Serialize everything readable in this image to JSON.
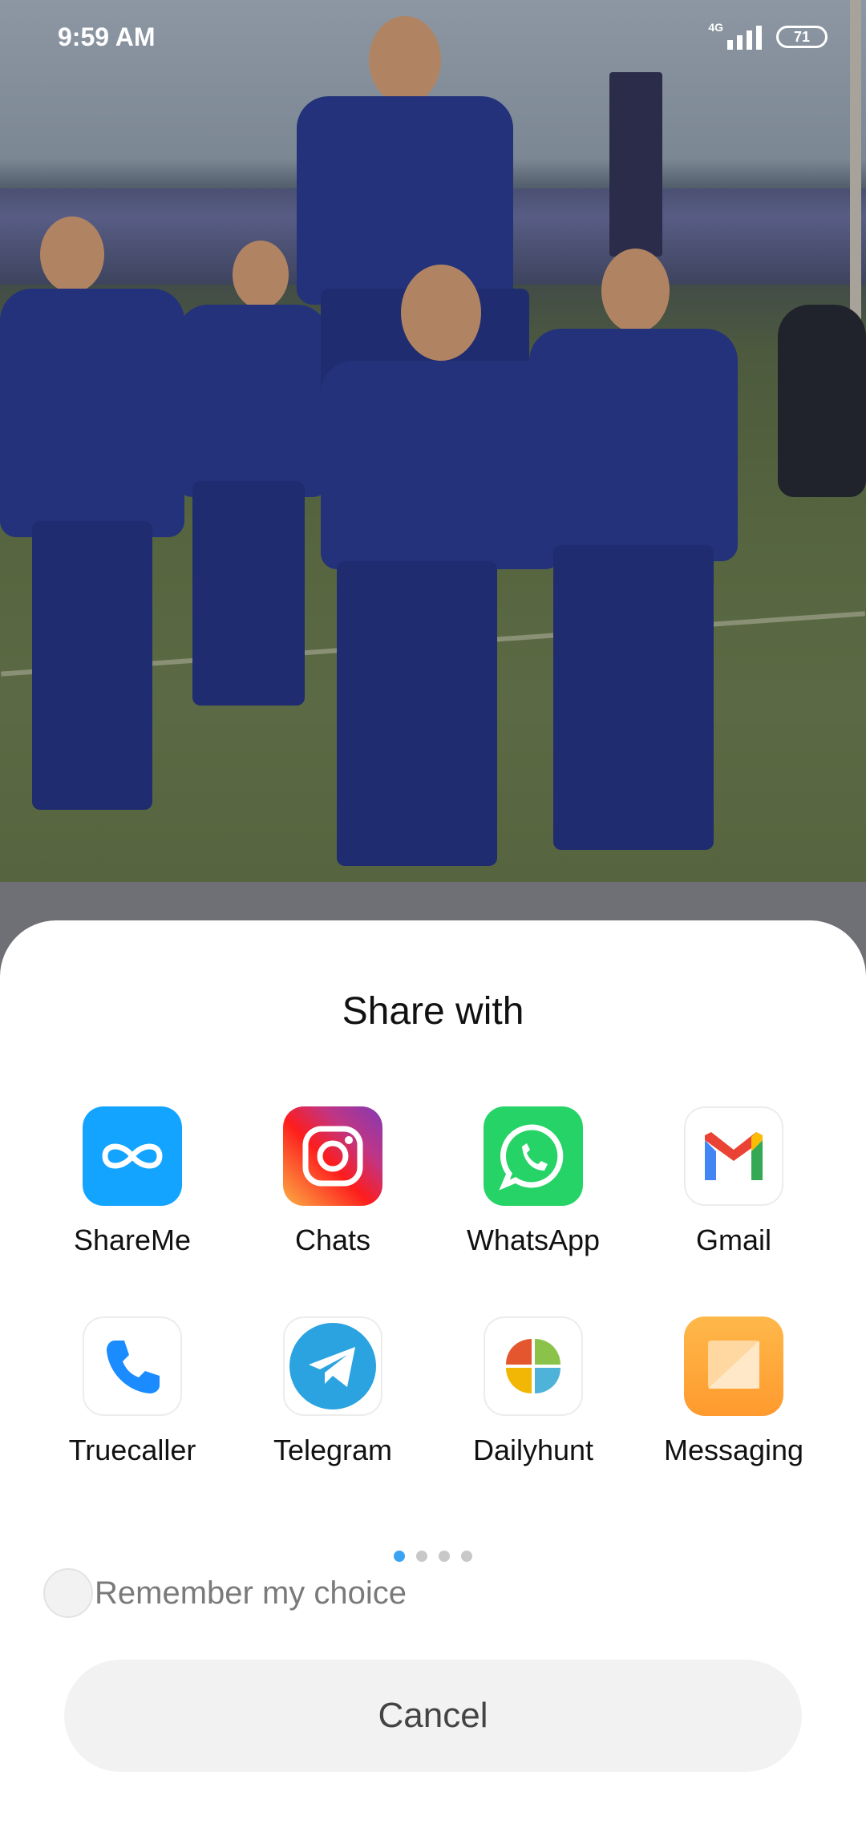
{
  "status_bar": {
    "time": "9:59 AM",
    "network": "4G",
    "battery": "71"
  },
  "share_sheet": {
    "title": "Share with",
    "apps": [
      {
        "label": "ShareMe",
        "icon": "shareme-icon"
      },
      {
        "label": "Chats",
        "icon": "instagram-icon"
      },
      {
        "label": "WhatsApp",
        "icon": "whatsapp-icon"
      },
      {
        "label": "Gmail",
        "icon": "gmail-icon"
      },
      {
        "label": "Truecaller",
        "icon": "truecaller-phone-icon"
      },
      {
        "label": "Telegram",
        "icon": "telegram-icon"
      },
      {
        "label": "Dailyhunt",
        "icon": "dailyhunt-icon"
      },
      {
        "label": "Messaging",
        "icon": "messaging-icon"
      }
    ],
    "pager": {
      "pages": 4,
      "active": 1
    },
    "remember_label": "Remember my choice",
    "cancel_label": "Cancel"
  },
  "colors": {
    "accent_dot": "#3aa3f2",
    "shareme": "#1aa3ff",
    "whatsapp": "#25d366",
    "telegram": "#2aa3e0",
    "messaging": "#ffa83a"
  }
}
